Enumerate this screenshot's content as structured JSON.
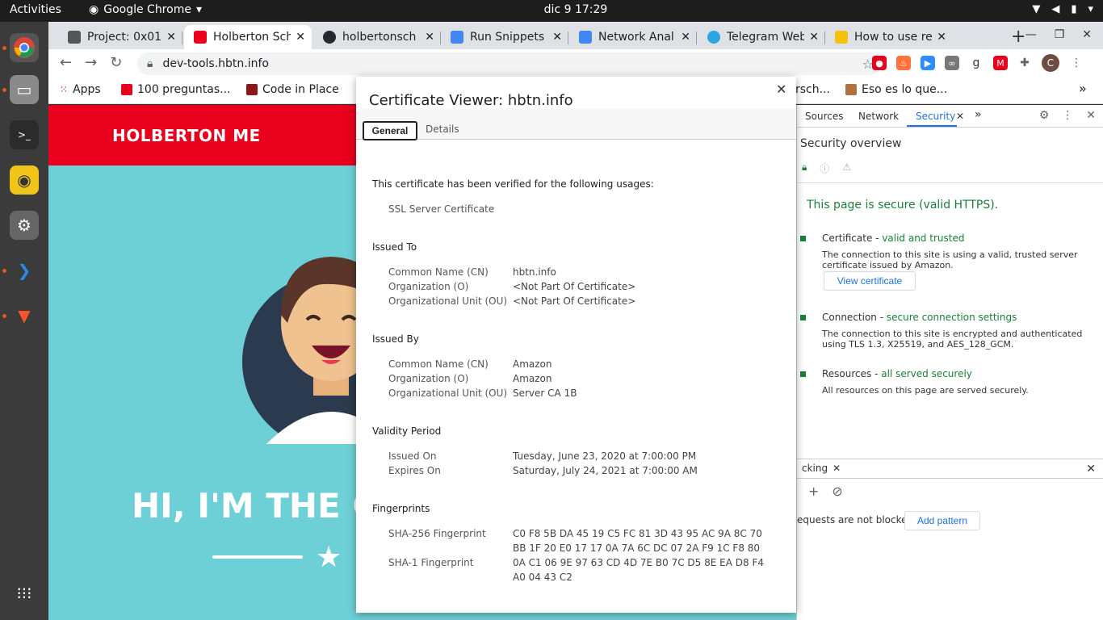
{
  "topbar": {
    "activities": "Activities",
    "app": "Google Chrome",
    "clock": "dic 9  17:29"
  },
  "tabs": [
    {
      "title": "Project: 0x01.",
      "color": "#555"
    },
    {
      "title": "Holberton Sch",
      "color": "#e8001c"
    },
    {
      "title": "holbertonsch",
      "color": "#24292e"
    },
    {
      "title": "Run Snippets",
      "color": "#4285f4"
    },
    {
      "title": "Network Anal",
      "color": "#4285f4"
    },
    {
      "title": "Telegram Web",
      "color": "#2ca5e0"
    },
    {
      "title": "How to use re",
      "color": "#f4c20d"
    }
  ],
  "toolbar": {
    "url": "dev-tools.hbtn.info",
    "avatar": "C"
  },
  "bookmarks": [
    {
      "label": "Apps"
    },
    {
      "label": "100 preguntas..."
    },
    {
      "label": "Code in Place"
    },
    {
      "label": "rsch..."
    },
    {
      "label": "Eso es lo que..."
    }
  ],
  "page": {
    "brand": "HOLBERTON ME",
    "headline": "HI, I'M THE C"
  },
  "devtools": {
    "tabs": [
      "Sources",
      "Network",
      "Security"
    ],
    "overview": "Security overview",
    "secure_msg": "This page is secure (valid HTTPS).",
    "cert": {
      "label": "Certificate - ",
      "status": "valid and trusted",
      "desc": "The connection to this site is using a valid, trusted server certificate issued by Amazon.",
      "button": "View certificate"
    },
    "conn": {
      "label": "Connection - ",
      "status": "secure connection settings",
      "desc": "The connection to this site is encrypted and authenticated using TLS 1.3, X25519, and AES_128_GCM."
    },
    "res": {
      "label": "Resources - ",
      "status": "all served securely",
      "desc": "All resources on this page are served securely."
    },
    "drawer": {
      "tab": "cking",
      "msg": "equests are not blocked.",
      "button": "Add pattern"
    }
  },
  "viewer": {
    "title": "Certificate Viewer: hbtn.info",
    "tab_general": "General",
    "tab_details": "Details",
    "usage_heading": "This certificate has been verified for the following usages:",
    "usage": "SSL Server Certificate",
    "issued_to": "Issued To",
    "issued_by": "Issued By",
    "validity": "Validity Period",
    "fingerprints": "Fingerprints",
    "k_cn": "Common Name (CN)",
    "k_o": "Organization (O)",
    "k_ou": "Organizational Unit (OU)",
    "to_cn": "hbtn.info",
    "to_o": "<Not Part Of Certificate>",
    "to_ou": "<Not Part Of Certificate>",
    "by_cn": "Amazon",
    "by_o": "Amazon",
    "by_ou": "Server CA 1B",
    "k_on": "Issued On",
    "k_exp": "Expires On",
    "issued_on": "Tuesday, June 23, 2020 at 7:00:00 PM",
    "expires_on": "Saturday, July 24, 2021 at 7:00:00 AM",
    "k_sha256": "SHA-256 Fingerprint",
    "k_sha1": "SHA-1 Fingerprint",
    "sha256_1": "C0 F8 5B DA 45 19 C5 FC 81 3D 43 95 AC 9A 8C 70",
    "sha256_2": "BB 1F 20 E0 17 17 0A 7A 6C DC 07 2A F9 1C F8 80",
    "sha1_1": "0A C1 06 9E 97 63 CD 4D 7E B0 7C D5 8E EA D8 F4",
    "sha1_2": "A0 04 43 C2"
  }
}
